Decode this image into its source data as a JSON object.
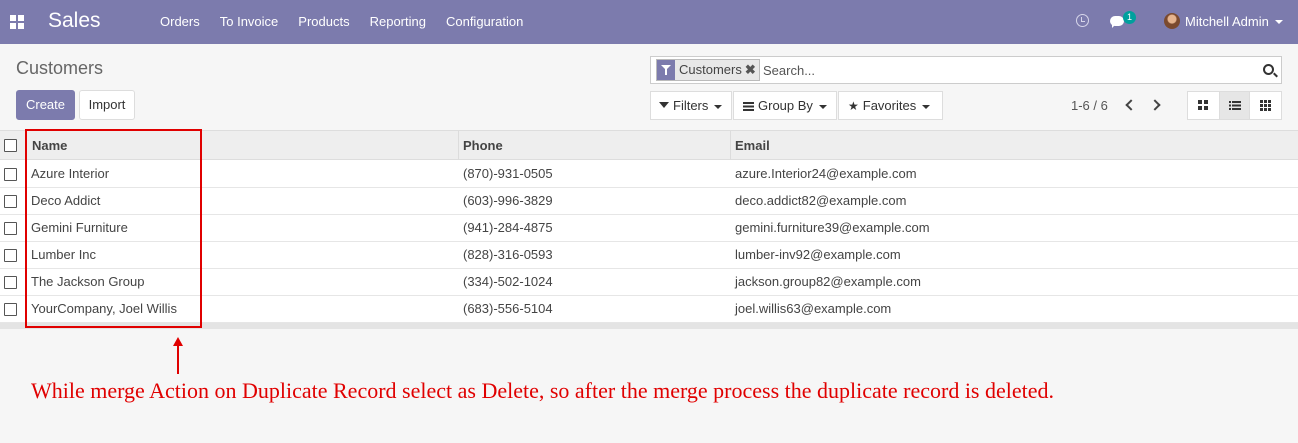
{
  "navbar": {
    "app_name": "Sales",
    "menu": [
      "Orders",
      "To Invoice",
      "Products",
      "Reporting",
      "Configuration"
    ],
    "chat_badge": "1",
    "user_name": "Mitchell Admin",
    "color": "#7c7bad"
  },
  "control_panel": {
    "title": "Customers",
    "create_label": "Create",
    "import_label": "Import",
    "search": {
      "facet": "Customers",
      "facet_remove": "✖",
      "placeholder": "Search..."
    },
    "filters_label": "Filters",
    "groupby_label": "Group By",
    "favorites_label": "Favorites",
    "favorites_icon": "★",
    "pager": "1-6 / 6"
  },
  "table": {
    "headers": {
      "name": "Name",
      "phone": "Phone",
      "email": "Email"
    },
    "rows": [
      {
        "name": "Azure Interior",
        "phone": "(870)-931-0505",
        "email": "azure.Interior24@example.com"
      },
      {
        "name": "Deco Addict",
        "phone": "(603)-996-3829",
        "email": "deco.addict82@example.com"
      },
      {
        "name": "Gemini Furniture",
        "phone": "(941)-284-4875",
        "email": "gemini.furniture39@example.com"
      },
      {
        "name": "Lumber Inc",
        "phone": "(828)-316-0593",
        "email": "lumber-inv92@example.com"
      },
      {
        "name": "The Jackson Group",
        "phone": "(334)-502-1024",
        "email": "jackson.group82@example.com"
      },
      {
        "name": "YourCompany, Joel Willis",
        "phone": "(683)-556-5104",
        "email": "joel.willis63@example.com"
      }
    ]
  },
  "annotation": {
    "text": "While merge Action on Duplicate Record select as Delete, so after the merge process the duplicate record is deleted.",
    "color": "#e00000"
  }
}
